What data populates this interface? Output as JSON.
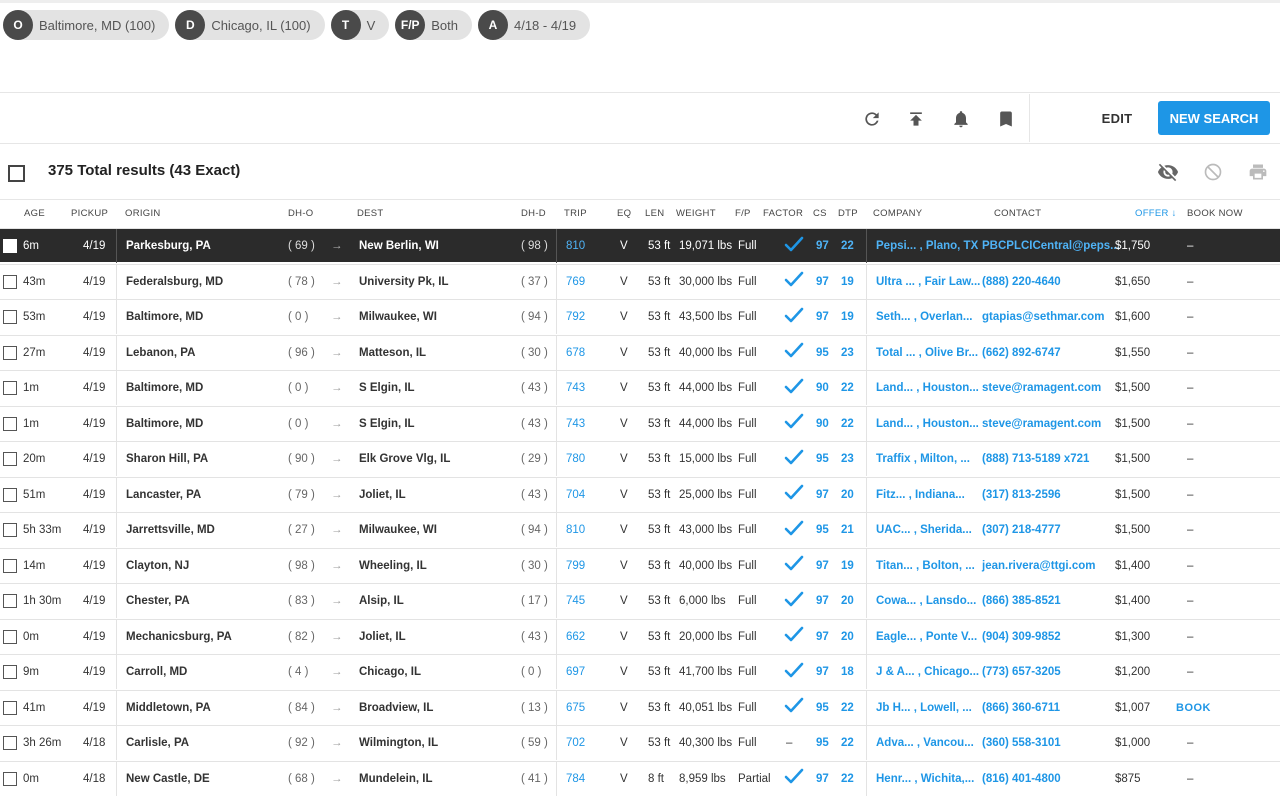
{
  "search_chips": [
    {
      "letter": "O",
      "value": "Baltimore, MD (100)"
    },
    {
      "letter": "D",
      "value": "Chicago, IL (100)"
    },
    {
      "letter": "T",
      "value": "V"
    },
    {
      "letter": "F/P",
      "value": "Both"
    },
    {
      "letter": "A",
      "value": "4/18 - 4/19"
    }
  ],
  "toolbar": {
    "edit_label": "EDIT",
    "new_search_label": "NEW SEARCH"
  },
  "results": {
    "total_label": "375 Total results (43 Exact)"
  },
  "columns": {
    "age": "AGE",
    "pickup": "PICKUP",
    "origin": "ORIGIN",
    "dh_o": "DH-O",
    "dest": "DEST",
    "dh_d": "DH-D",
    "trip": "TRIP",
    "eq": "EQ",
    "len": "LEN",
    "weight": "WEIGHT",
    "fp": "F/P",
    "factor": "FACTOR",
    "cs": "CS",
    "dtp": "DTP",
    "company": "COMPANY",
    "contact": "CONTACT",
    "offer": "OFFER",
    "book_now": "BOOK NOW"
  },
  "rows": [
    {
      "age": "6m",
      "pickup": "4/19",
      "origin": "Parkesburg, PA",
      "dh_o": "( 69 )",
      "dest": "New Berlin, WI",
      "dh_d": "( 98 )",
      "trip": "810",
      "eq": "V",
      "len": "53 ft",
      "weight": "19,071 lbs",
      "fp": "Full",
      "factor": "check",
      "cs": "97",
      "dtp": "22",
      "company": "Pepsi... , Plano, TX",
      "contact": "PBCPLCICentral@peps...",
      "offer": "$1,750",
      "book": "–"
    },
    {
      "age": "43m",
      "pickup": "4/19",
      "origin": "Federalsburg, MD",
      "dh_o": "( 78 )",
      "dest": "University Pk, IL",
      "dh_d": "( 37 )",
      "trip": "769",
      "eq": "V",
      "len": "53 ft",
      "weight": "30,000 lbs",
      "fp": "Full",
      "factor": "check",
      "cs": "97",
      "dtp": "19",
      "company": "Ultra ... , Fair Law...",
      "contact": "(888) 220-4640",
      "offer": "$1,650",
      "book": "–"
    },
    {
      "age": "53m",
      "pickup": "4/19",
      "origin": "Baltimore, MD",
      "dh_o": "( 0 )",
      "dest": "Milwaukee, WI",
      "dh_d": "( 94 )",
      "trip": "792",
      "eq": "V",
      "len": "53 ft",
      "weight": "43,500 lbs",
      "fp": "Full",
      "factor": "check",
      "cs": "97",
      "dtp": "19",
      "company": "Seth... , Overlan...",
      "contact": "gtapias@sethmar.com",
      "offer": "$1,600",
      "book": "–"
    },
    {
      "age": "27m",
      "pickup": "4/19",
      "origin": "Lebanon, PA",
      "dh_o": "( 96 )",
      "dest": "Matteson, IL",
      "dh_d": "( 30 )",
      "trip": "678",
      "eq": "V",
      "len": "53 ft",
      "weight": "40,000 lbs",
      "fp": "Full",
      "factor": "check",
      "cs": "95",
      "dtp": "23",
      "company": "Total ... , Olive Br...",
      "contact": "(662) 892-6747",
      "offer": "$1,550",
      "book": "–"
    },
    {
      "age": "1m",
      "pickup": "4/19",
      "origin": "Baltimore, MD",
      "dh_o": "( 0 )",
      "dest": "S Elgin, IL",
      "dh_d": "( 43 )",
      "trip": "743",
      "eq": "V",
      "len": "53 ft",
      "weight": "44,000 lbs",
      "fp": "Full",
      "factor": "check",
      "cs": "90",
      "dtp": "22",
      "company": "Land... , Houston...",
      "contact": "steve@ramagent.com",
      "offer": "$1,500",
      "book": "–"
    },
    {
      "age": "1m",
      "pickup": "4/19",
      "origin": "Baltimore, MD",
      "dh_o": "( 0 )",
      "dest": "S Elgin, IL",
      "dh_d": "( 43 )",
      "trip": "743",
      "eq": "V",
      "len": "53 ft",
      "weight": "44,000 lbs",
      "fp": "Full",
      "factor": "check",
      "cs": "90",
      "dtp": "22",
      "company": "Land... , Houston...",
      "contact": "steve@ramagent.com",
      "offer": "$1,500",
      "book": "–"
    },
    {
      "age": "20m",
      "pickup": "4/19",
      "origin": "Sharon Hill, PA",
      "dh_o": "( 90 )",
      "dest": "Elk Grove Vlg, IL",
      "dh_d": "( 29 )",
      "trip": "780",
      "eq": "V",
      "len": "53 ft",
      "weight": "15,000 lbs",
      "fp": "Full",
      "factor": "check",
      "cs": "95",
      "dtp": "23",
      "company": "Traffix , Milton, ...",
      "contact": "(888) 713-5189 x721",
      "offer": "$1,500",
      "book": "–"
    },
    {
      "age": "51m",
      "pickup": "4/19",
      "origin": "Lancaster, PA",
      "dh_o": "( 79 )",
      "dest": "Joliet, IL",
      "dh_d": "( 43 )",
      "trip": "704",
      "eq": "V",
      "len": "53 ft",
      "weight": "25,000 lbs",
      "fp": "Full",
      "factor": "check",
      "cs": "97",
      "dtp": "20",
      "company": "Fitz... , Indiana...",
      "contact": "(317) 813-2596",
      "offer": "$1,500",
      "book": "–"
    },
    {
      "age": "5h 33m",
      "pickup": "4/19",
      "origin": "Jarrettsville, MD",
      "dh_o": "( 27 )",
      "dest": "Milwaukee, WI",
      "dh_d": "( 94 )",
      "trip": "810",
      "eq": "V",
      "len": "53 ft",
      "weight": "43,000 lbs",
      "fp": "Full",
      "factor": "check",
      "cs": "95",
      "dtp": "21",
      "company": "UAC... , Sherida...",
      "contact": "(307) 218-4777",
      "offer": "$1,500",
      "book": "–"
    },
    {
      "age": "14m",
      "pickup": "4/19",
      "origin": "Clayton, NJ",
      "dh_o": "( 98 )",
      "dest": "Wheeling, IL",
      "dh_d": "( 30 )",
      "trip": "799",
      "eq": "V",
      "len": "53 ft",
      "weight": "40,000 lbs",
      "fp": "Full",
      "factor": "check",
      "cs": "97",
      "dtp": "19",
      "company": "Titan... , Bolton, ...",
      "contact": "jean.rivera@ttgi.com",
      "offer": "$1,400",
      "book": "–"
    },
    {
      "age": "1h 30m",
      "pickup": "4/19",
      "origin": "Chester, PA",
      "dh_o": "( 83 )",
      "dest": "Alsip, IL",
      "dh_d": "( 17 )",
      "trip": "745",
      "eq": "V",
      "len": "53 ft",
      "weight": "6,000 lbs",
      "fp": "Full",
      "factor": "check",
      "cs": "97",
      "dtp": "20",
      "company": "Cowa... , Lansdo...",
      "contact": "(866) 385-8521",
      "offer": "$1,400",
      "book": "–"
    },
    {
      "age": "0m",
      "pickup": "4/19",
      "origin": "Mechanicsburg, PA",
      "dh_o": "( 82 )",
      "dest": "Joliet, IL",
      "dh_d": "( 43 )",
      "trip": "662",
      "eq": "V",
      "len": "53 ft",
      "weight": "20,000 lbs",
      "fp": "Full",
      "factor": "check",
      "cs": "97",
      "dtp": "20",
      "company": "Eagle... , Ponte V...",
      "contact": "(904) 309-9852",
      "offer": "$1,300",
      "book": "–"
    },
    {
      "age": "9m",
      "pickup": "4/19",
      "origin": "Carroll, MD",
      "dh_o": "( 4 )",
      "dest": "Chicago, IL",
      "dh_d": "( 0 )",
      "trip": "697",
      "eq": "V",
      "len": "53 ft",
      "weight": "41,700 lbs",
      "fp": "Full",
      "factor": "check",
      "cs": "97",
      "dtp": "18",
      "company": "J & A... , Chicago...",
      "contact": "(773) 657-3205",
      "offer": "$1,200",
      "book": "–"
    },
    {
      "age": "41m",
      "pickup": "4/19",
      "origin": "Middletown, PA",
      "dh_o": "( 84 )",
      "dest": "Broadview, IL",
      "dh_d": "( 13 )",
      "trip": "675",
      "eq": "V",
      "len": "53 ft",
      "weight": "40,051 lbs",
      "fp": "Full",
      "factor": "check",
      "cs": "95",
      "dtp": "22",
      "company": "Jb H... , Lowell, ...",
      "contact": "(866) 360-6711",
      "offer": "$1,007",
      "book": "BOOK"
    },
    {
      "age": "3h 26m",
      "pickup": "4/18",
      "origin": "Carlisle, PA",
      "dh_o": "( 92 )",
      "dest": "Wilmington, IL",
      "dh_d": "( 59 )",
      "trip": "702",
      "eq": "V",
      "len": "53 ft",
      "weight": "40,300 lbs",
      "fp": "Full",
      "factor": "–",
      "cs": "95",
      "dtp": "22",
      "company": "Adva... , Vancou...",
      "contact": "(360) 558-3101",
      "offer": "$1,000",
      "book": "–"
    },
    {
      "age": "0m",
      "pickup": "4/18",
      "origin": "New Castle, DE",
      "dh_o": "( 68 )",
      "dest": "Mundelein, IL",
      "dh_d": "( 41 )",
      "trip": "784",
      "eq": "V",
      "len": "8 ft",
      "weight": "8,959 lbs",
      "fp": "Partial",
      "factor": "check",
      "cs": "97",
      "dtp": "22",
      "company": "Henr... , Wichita,...",
      "contact": "(816) 401-4800",
      "offer": "$875",
      "book": "–"
    }
  ],
  "accent_color": "#1e96e6",
  "selected_row_color": "#2b2b2b"
}
